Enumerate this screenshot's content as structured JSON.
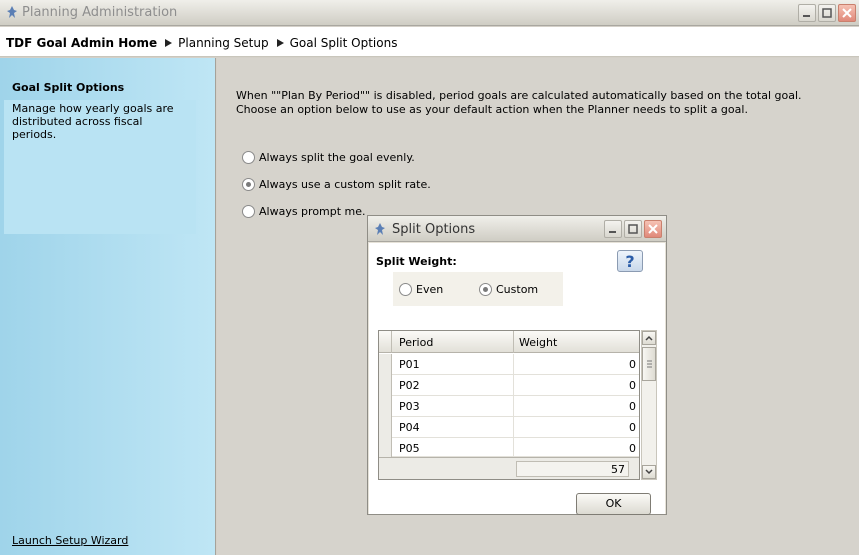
{
  "window": {
    "title": "Planning Administration"
  },
  "breadcrumb": {
    "home": "TDF Goal Admin Home",
    "level2": "Planning Setup",
    "level3": "Goal Split Options"
  },
  "sidebar": {
    "heading": "Goal Split Options",
    "description": "Manage how yearly goals are distributed across fiscal periods.",
    "wizard_link": "Launch Setup Wizard"
  },
  "main": {
    "intro": "When \"\"Plan By Period\"\" is disabled, period goals are calculated automatically based on the total goal. Choose an option below to use as your default action when the Planner needs to split a goal.",
    "options": [
      {
        "label": "Always split the goal evenly.",
        "checked": false
      },
      {
        "label": "Always use a custom split rate.",
        "checked": true
      },
      {
        "label": "Always prompt me.",
        "checked": false
      }
    ]
  },
  "dialog": {
    "title": "Split Options",
    "split_weight_label": "Split Weight:",
    "even_label": "Even",
    "custom_label": "Custom",
    "columns": {
      "period": "Period",
      "weight": "Weight"
    },
    "rows": [
      {
        "period": "P01",
        "weight": "0"
      },
      {
        "period": "P02",
        "weight": "0"
      },
      {
        "period": "P03",
        "weight": "0"
      },
      {
        "period": "P04",
        "weight": "0"
      },
      {
        "period": "P05",
        "weight": "0"
      }
    ],
    "total": "57",
    "ok_label": "OK"
  },
  "colors": {
    "sidebar": "#b9e3f3",
    "content": "#d6d3cc",
    "close_button": "#e0897a"
  }
}
